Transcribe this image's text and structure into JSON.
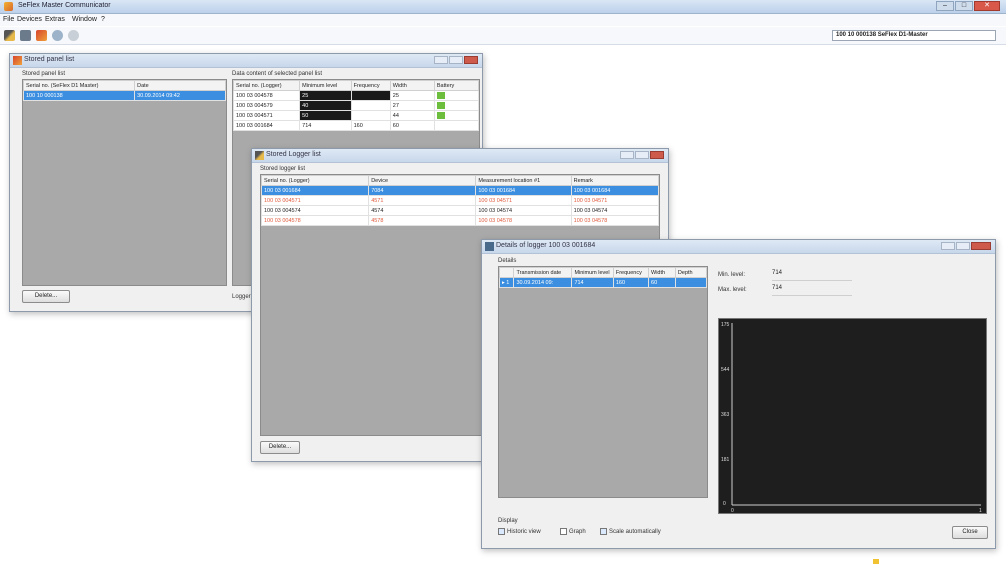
{
  "app": {
    "title": "SeFlex Master Communicator",
    "menu": [
      "File",
      "Devices",
      "Extras",
      "Window",
      "?"
    ],
    "device_selector": "100 10 000138   SeFlex D1-Master"
  },
  "win_panels": {
    "title": "Stored panel list",
    "stored_label": "Stored panel list",
    "columns": [
      "Serial no. (SeFlex D1 Master)",
      "Date"
    ],
    "rows": [
      [
        "100 10 000138",
        "30.09.2014 09:42"
      ]
    ],
    "content_label": "Data content of selected panel list",
    "content_columns": [
      "Serial no. (Logger)",
      "Minimum level",
      "Frequency",
      "Width",
      "Battery"
    ],
    "content_rows": [
      [
        "100 03 004578",
        "25",
        "",
        "25",
        ""
      ],
      [
        "100 03 004579",
        "40",
        "",
        "27",
        ""
      ],
      [
        "100 03 004571",
        "50",
        "",
        "44",
        ""
      ],
      [
        "100 03 001684",
        "714",
        "160",
        "60",
        ""
      ]
    ],
    "delete_label": "Delete...",
    "logger_label": "Logger"
  },
  "win_loggers": {
    "title": "Stored Logger list",
    "stored_label": "Stored logger list",
    "columns": [
      "Serial no. (Logger)",
      "Device",
      "Measurement location #1",
      "Remark"
    ],
    "rows": [
      [
        "100 03 001684",
        "7084",
        "100 03 001684",
        "100 03 001684"
      ],
      [
        "100 03 004571",
        "4571",
        "100 03 04571",
        "100 03 04571"
      ],
      [
        "100 03 004574",
        "4574",
        "100 03 04574",
        "100 03 04574"
      ],
      [
        "100 03 004578",
        "4578",
        "100 03 04578",
        "100 03 04578"
      ]
    ],
    "delete_label": "Delete..."
  },
  "win_details": {
    "title": "Details of logger 100 03 001684",
    "details_label": "Details",
    "columns": [
      "",
      "Transmission date",
      "Minimum level",
      "Frequency",
      "Width",
      "Depth"
    ],
    "rows": [
      [
        "1",
        "30.09.2014 09:",
        "714",
        "160",
        "60",
        ""
      ]
    ],
    "min_level_label": "Min. level:",
    "min_level_value": "714",
    "max_level_label": "Max. level:",
    "max_level_value": "714",
    "y_ticks": [
      "175",
      "544",
      "363",
      "181",
      "0"
    ],
    "x_ticks": [
      "0",
      "1"
    ],
    "display_label": "Display",
    "opt_historic": "Historic view",
    "opt_graph": "Graph",
    "opt_scale": "Scale automatically",
    "close_label": "Close"
  }
}
